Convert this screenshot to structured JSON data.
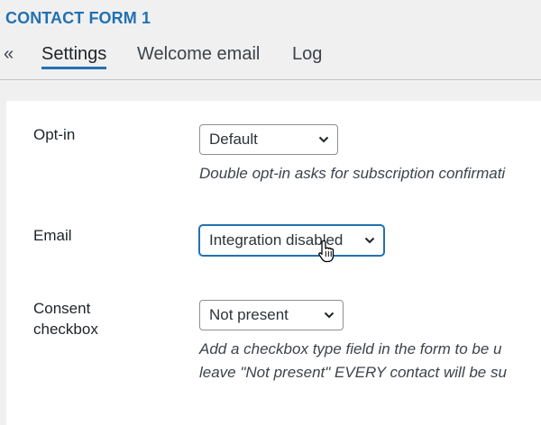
{
  "header": {
    "title": "CONTACT FORM 1"
  },
  "tabs": {
    "back": "«",
    "items": [
      {
        "label": "Settings",
        "active": true
      },
      {
        "label": "Welcome email",
        "active": false
      },
      {
        "label": "Log",
        "active": false
      }
    ]
  },
  "settings": {
    "optin": {
      "label": "Opt-in",
      "selected": "Default",
      "description": "Double opt-in asks for subscription confirmati"
    },
    "email": {
      "label": "Email",
      "selected": "Integration disabled"
    },
    "consent": {
      "label_line1": "Consent",
      "label_line2": "checkbox",
      "selected": "Not present",
      "description_line1": "Add a checkbox type field in the form to be u",
      "description_line2": "leave \"Not present\" EVERY contact will be su"
    }
  },
  "icons": {
    "dropdown": "chevron-down-icon",
    "cursor": "hand-pointer-icon"
  },
  "colors": {
    "accent": "#2271b1",
    "background": "#f0f0f1",
    "panel": "#ffffff"
  }
}
